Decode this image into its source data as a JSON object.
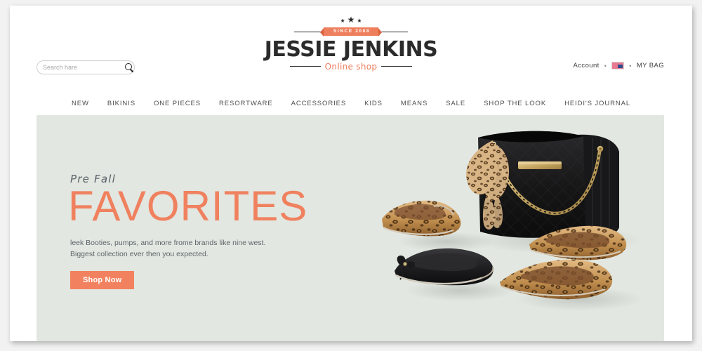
{
  "site": {
    "brand_accent": "#ee7f5d",
    "hero_bg": "#e2e7e1"
  },
  "header": {
    "search": {
      "placeholder": "Search hare",
      "value": "",
      "icon": "search-icon"
    },
    "logo": {
      "stars": [
        "★",
        "★",
        "★"
      ],
      "ribbon_text": "SINCE 2008",
      "name": "JESSIE JENKINS",
      "subtitle": "Online shop"
    },
    "account": {
      "account_label": "Account",
      "separator": "•",
      "flag_icon": "country-flag-icon",
      "bag_label": "MY BAG"
    }
  },
  "nav": {
    "items": [
      {
        "label": "NEW"
      },
      {
        "label": "BIKINIS"
      },
      {
        "label": "ONE PIECES"
      },
      {
        "label": "RESORTWARE"
      },
      {
        "label": "ACCESSORIES"
      },
      {
        "label": "KIDS"
      },
      {
        "label": "MEANS"
      },
      {
        "label": "SALE"
      },
      {
        "label": "SHOP THE LOOK"
      },
      {
        "label": "HEIDI'S JOURNAL"
      }
    ]
  },
  "hero": {
    "eyebrow": "Pre Fall",
    "title": "FAVORITES",
    "description_line1": "leek Booties, pumps, and more frome brands like nine west.",
    "description_line2": "Biggest collection ever then you expected.",
    "cta_label": "Shop Now",
    "photo_alt": "black quilted handbag with gold chain, leopard print scarf, leopard ballet flats, black ballet flat with bow and leopard pointed flats"
  }
}
